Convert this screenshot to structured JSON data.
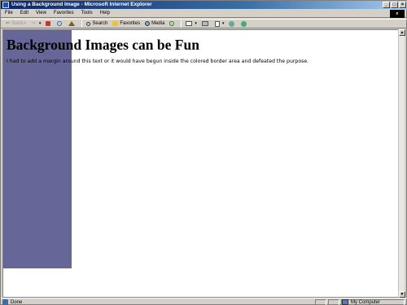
{
  "window": {
    "title": "Using a Background Image - Microsoft Internet Explorer",
    "minimize": "_",
    "maximize": "□",
    "close": "×"
  },
  "menu": [
    "File",
    "Edit",
    "View",
    "Favorites",
    "Tools",
    "Help"
  ],
  "toolbar": {
    "back": "Back",
    "search": "Search",
    "favorites": "Favorites",
    "media": "Media"
  },
  "page": {
    "heading": "Background Images can be Fun",
    "body_text": "I had to add a margin around this text or it would have begun inside the colored border area and defeated the purpose.",
    "band_color": "#666699"
  },
  "status": {
    "text": "Done",
    "zone": "My Computer"
  },
  "icons": [
    "ie-app-icon",
    "back-arrow-icon",
    "forward-arrow-icon",
    "stop-icon",
    "refresh-icon",
    "home-icon",
    "search-icon",
    "favorites-icon",
    "media-icon",
    "history-icon",
    "mail-icon",
    "print-icon",
    "edit-icon",
    "discuss-icon",
    "messenger-icon",
    "done-page-icon",
    "my-computer-icon"
  ]
}
